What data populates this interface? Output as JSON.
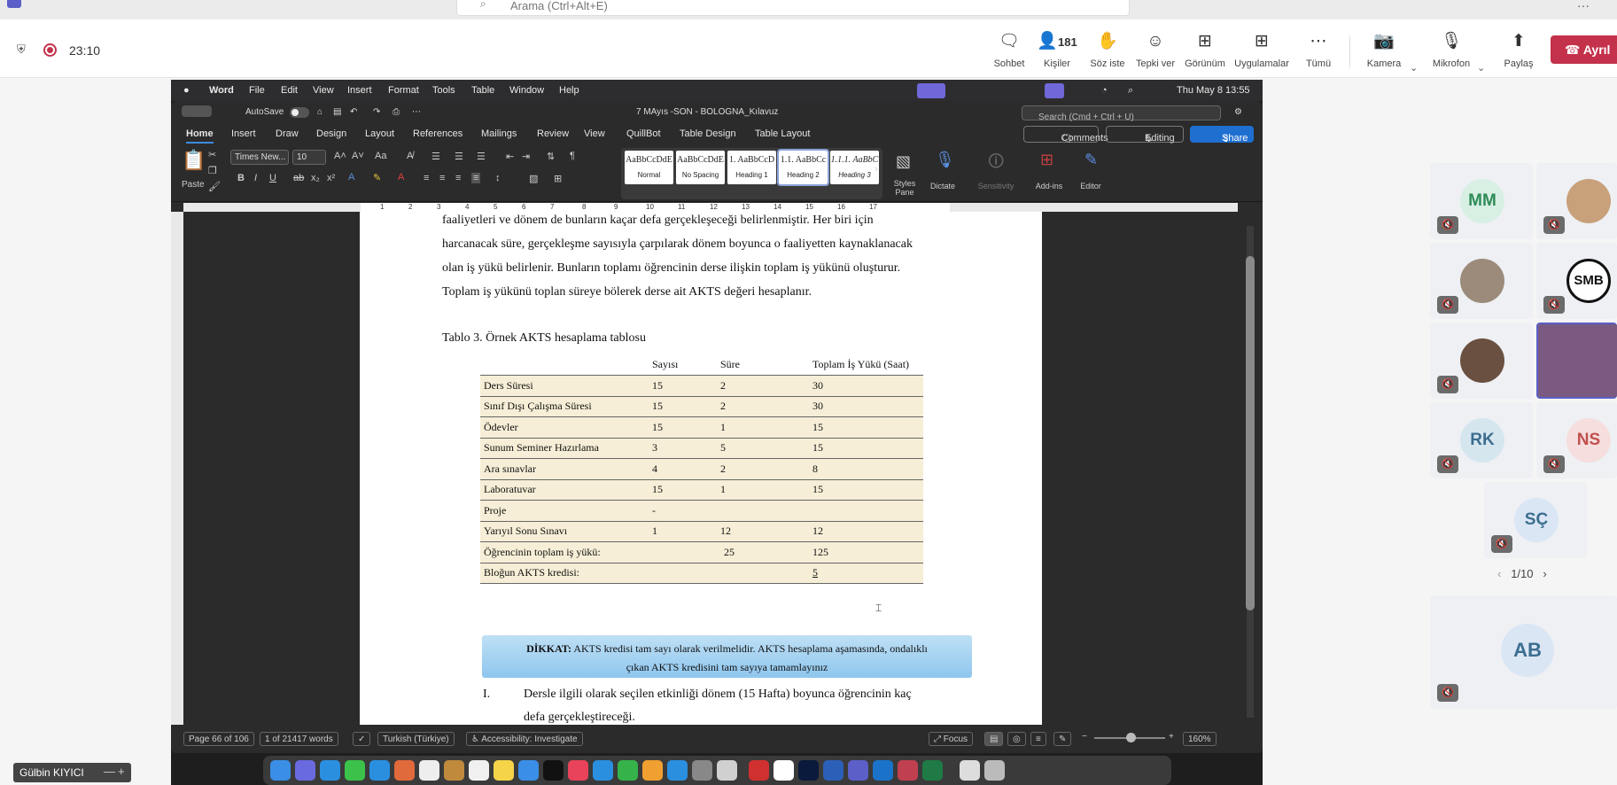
{
  "teams": {
    "search_placeholder": "Arama (Ctrl+Alt+E)",
    "more": "···",
    "timer": "23:10",
    "people_count": "181",
    "buttons": {
      "chat": "Sohbet",
      "people": "Kişiler",
      "raise": "Söz iste",
      "react": "Tepki ver",
      "view": "Görünüm",
      "apps": "Uygulamalar",
      "more": "Tümü",
      "camera": "Kamera",
      "mic": "Mikrofon",
      "share": "Paylaş",
      "leave": "Ayrıl"
    },
    "presenter_name": "Gülbin KIYICI",
    "pager": "1/10",
    "participants": [
      {
        "initials": "MM",
        "color": "#2e8b57",
        "bg": "#d8efe4"
      },
      {
        "initials": "",
        "color": "",
        "bg": ""
      },
      {
        "initials": "",
        "color": "",
        "bg": ""
      },
      {
        "initials": "SMB",
        "color": "#111",
        "bg": "#fff"
      },
      {
        "initials": "",
        "color": "",
        "bg": ""
      },
      {
        "initials": "",
        "color": "",
        "bg": ""
      },
      {
        "initials": "RK",
        "color": "#3b6e8f",
        "bg": "#d6e6ef"
      },
      {
        "initials": "NS",
        "color": "#c0504d",
        "bg": "#f6dede"
      },
      {
        "initials": "SÇ",
        "color": "#3b6e8f",
        "bg": "#dbe6f5"
      },
      {
        "initials": "AB",
        "color": "#3b6e8f",
        "bg": "#dbe6f5"
      }
    ]
  },
  "mac": {
    "menubar": [
      "Word",
      "File",
      "Edit",
      "View",
      "Insert",
      "Format",
      "Tools",
      "Table",
      "Window",
      "Help"
    ],
    "clock": "Thu May 8  13:55"
  },
  "word": {
    "autosave": "AutoSave",
    "doc_title": "7 MAyıs -SON - BOLOGNA_Kılavuz",
    "search": "Search (Cmd + Ctrl + U)",
    "tabs": [
      "Home",
      "Insert",
      "Draw",
      "Design",
      "Layout",
      "References",
      "Mailings",
      "Review",
      "View",
      "QuillBot",
      "Table Design",
      "Table Layout"
    ],
    "comments": "Comments",
    "editing": "Editing",
    "share": "Share",
    "font_name": "Times New...",
    "font_size": "10",
    "paste": "Paste",
    "styles": [
      {
        "preview": "AaBbCcDdE",
        "name": "Normal"
      },
      {
        "preview": "AaBbCcDdE",
        "name": "No Spacing"
      },
      {
        "preview": "1. AaBbCcD",
        "name": "Heading 1"
      },
      {
        "preview": "1.1. AaBbCc",
        "name": "Heading 2"
      },
      {
        "preview": "1.1.1. AaBbC",
        "name": "Heading 3"
      }
    ],
    "ribbon_labels": {
      "styles_pane": "Styles Pane",
      "dictate": "Dictate",
      "sensitivity": "Sensitivity",
      "addins": "Add-ins",
      "editor": "Editor"
    },
    "ruler_numbers": [
      "1",
      "2",
      "3",
      "4",
      "5",
      "6",
      "7",
      "8",
      "9",
      "10",
      "11",
      "12",
      "13",
      "14",
      "15",
      "16",
      "17"
    ],
    "body_lines": [
      "faaliyetleri ve dönem de bunların kaçar defa gerçekleşeceği belirlenmiştir. Her biri için",
      "harcanacak süre, gerçekleşme sayısıyla çarpılarak dönem boyunca o faaliyetten kaynaklanacak",
      "olan iş yükü belirlenir. Bunların toplamı öğrencinin derse ilişkin toplam iş yükünü oluşturur.",
      "Toplam iş yükünü toplan süreye bölerek derse ait AKTS değeri hesaplanır."
    ],
    "table_caption": "Tablo 3. Örnek AKTS hesaplama tablosu",
    "table": {
      "headers": [
        "",
        "Sayısı",
        "Süre",
        "Toplam İş Yükü (Saat)"
      ],
      "rows": [
        [
          "Ders Süresi",
          "15",
          "2",
          "30"
        ],
        [
          "Sınıf Dışı Çalışma Süresi",
          "15",
          "2",
          "30"
        ],
        [
          "Ödevler",
          "15",
          "1",
          "15"
        ],
        [
          "Sunum Seminer Hazırlama",
          "3",
          "5",
          "15"
        ],
        [
          "Ara sınavlar",
          "4",
          "2",
          "8"
        ],
        [
          "Laboratuvar",
          "15",
          "1",
          "15"
        ],
        [
          "Proje",
          "-",
          "",
          ""
        ],
        [
          "Yarıyıl Sonu Sınavı",
          "1",
          "12",
          "12"
        ],
        [
          "Öğrencinin toplam iş yükü:",
          "",
          "25",
          "125"
        ],
        [
          "Bloğun AKTS kredisi:",
          "",
          "",
          "5"
        ]
      ]
    },
    "notice_bold": "DİKKAT:",
    "notice_line1": "AKTS kredisi tam sayı olarak verilmelidir. AKTS hesaplama aşamasında, ondalıklı",
    "notice_line2": "çıkan AKTS kredisini tam sayıya tamamlayınız",
    "list_num": "I.",
    "list_line1": "Dersle ilgili olarak seçilen etkinliği dönem (15 Hafta) boyunca öğrencinin kaç",
    "list_line2": "defa gerçekleştireceği.",
    "status": {
      "page": "Page 66 of 106",
      "words": "1 of 21417 words",
      "language": "Turkish (Türkiye)",
      "accessibility": "Accessibility: Investigate",
      "focus": "Focus",
      "zoom": "160%"
    }
  }
}
